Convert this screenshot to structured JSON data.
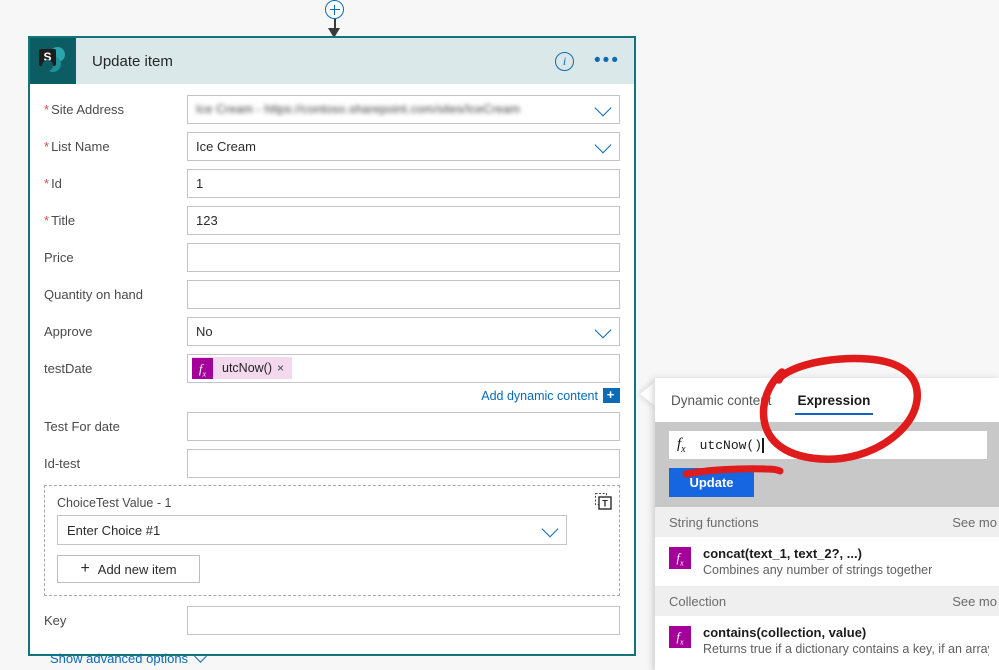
{
  "connector": {
    "add_icon": "plus-circle-icon",
    "arrow_icon": "arrow-down-icon"
  },
  "card": {
    "logo_letter": "S",
    "title": "Update item",
    "info_icon": "i",
    "more_icon": "•••",
    "fields": [
      {
        "label": "Site Address",
        "required": true,
        "value": "Ice Cream - https://contoso.sharepoint.com/sites/IceCream",
        "blurred": true,
        "control": "dropdown"
      },
      {
        "label": "List Name",
        "required": true,
        "value": "Ice Cream",
        "blurred": false,
        "control": "dropdown"
      },
      {
        "label": "Id",
        "required": true,
        "value": "1",
        "blurred": false,
        "control": "text"
      },
      {
        "label": "Title",
        "required": true,
        "value": "123",
        "blurred": false,
        "control": "text"
      },
      {
        "label": "Price",
        "required": false,
        "value": "",
        "blurred": false,
        "control": "text"
      },
      {
        "label": "Quantity on hand",
        "required": false,
        "value": "",
        "blurred": false,
        "control": "text"
      },
      {
        "label": "Approve",
        "required": false,
        "value": "No",
        "blurred": false,
        "control": "dropdown"
      }
    ],
    "test_date": {
      "label": "testDate",
      "token_label": "utcNow()",
      "token_fx": "fx",
      "token_remove": "×"
    },
    "dynamic_content": {
      "link": "Add dynamic content",
      "plus": "+"
    },
    "fields_after": [
      {
        "label": "Test For date",
        "required": false,
        "value": "",
        "control": "text"
      },
      {
        "label": "Id-test",
        "required": false,
        "value": "",
        "control": "text"
      }
    ],
    "choice_group": {
      "title": "ChoiceTest Value - 1",
      "select_value": "Enter Choice #1",
      "add_button": "Add new item",
      "add_icon": "plus-icon",
      "text_mode_icon": "text-mode-icon"
    },
    "key_field": {
      "label": "Key",
      "required": false,
      "value": "",
      "control": "text"
    },
    "advanced": {
      "label": "Show advanced options",
      "chevron": "chevron-down-icon"
    }
  },
  "panel": {
    "tabs": [
      {
        "label": "Dynamic content",
        "active": false
      },
      {
        "label": "Expression",
        "active": true
      }
    ],
    "expression": {
      "fx": "fx",
      "value": "utcNow()"
    },
    "update_button": "Update",
    "sections": [
      {
        "title": "String functions",
        "see_more": "See mo",
        "functions": [
          {
            "signature": "concat(text_1, text_2?, ...)",
            "description": "Combines any number of strings together"
          }
        ]
      },
      {
        "title": "Collection",
        "see_more": "See mo",
        "functions": [
          {
            "signature": "contains(collection, value)",
            "description": "Returns true if a dictionary contains a key, if an array con"
          }
        ]
      }
    ]
  },
  "annotations": {
    "circle_color": "#e01b1b",
    "underline_color": "#e01b1b",
    "circle_target": "Expression",
    "underline_target": "Update"
  },
  "colors": {
    "sharepoint_teal": "#0b5d63",
    "card_border": "#13757a",
    "header_bg": "#dbe8ea",
    "link_blue": "#0b6bb5",
    "button_blue": "#1566e0",
    "fx_magenta": "#a4009a",
    "token_pink": "#f3d9ee",
    "required_red": "#e04a3f",
    "annotation_red": "#e01b1b"
  }
}
